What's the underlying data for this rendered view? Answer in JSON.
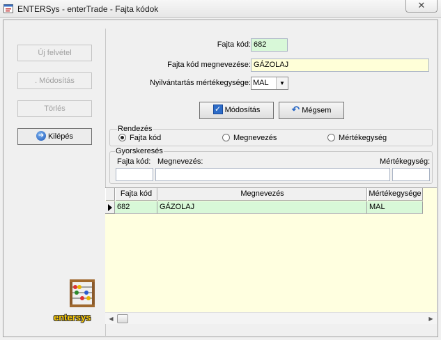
{
  "window": {
    "title": "ENTERSys - enterTrade - Fajta kódok",
    "close_label": "✕"
  },
  "sidebar": {
    "new_button": "Új felvétel",
    "modify_button": ". Módosítás",
    "delete_button": "Törlés",
    "exit_button": "Kilépés",
    "logo_text": "entersys"
  },
  "form": {
    "code_label": "Fajta kód:",
    "code_value": "682",
    "name_label": "Fajta kód megnevezése:",
    "name_value": "GÁZOLAJ",
    "unit_label": "Nyilvántartás mértékegysége:",
    "unit_value": "MAL",
    "modify_button": "Módosítás",
    "cancel_button": "Mégsem"
  },
  "sort": {
    "title": "Rendezés",
    "options": [
      "Fajta kód",
      "Megnevezés",
      "Mértékegység"
    ],
    "selected": "Fajta kód"
  },
  "quicksearch": {
    "title": "Gyorskeresés",
    "code_label": "Fajta kód:",
    "name_label": "Megnevezés:",
    "unit_label": "Mértékegység:"
  },
  "grid": {
    "columns": [
      "Fajta kód",
      "Megnevezés",
      "Mértékegysége"
    ],
    "rows": [
      [
        "682",
        "GÁZOLAJ",
        "MAL"
      ]
    ]
  },
  "colors": {
    "green_field": "#d8f8d8",
    "yellow_field": "#ffffd8",
    "grid_background": "#ffffe0"
  }
}
